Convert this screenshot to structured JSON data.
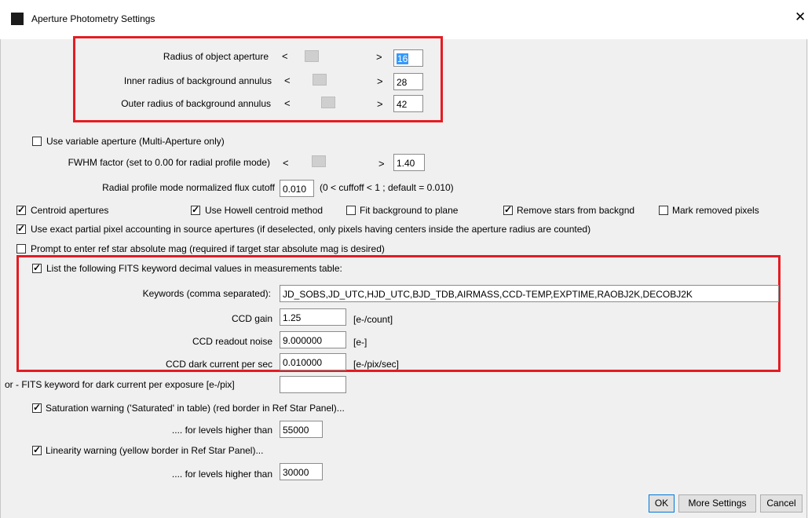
{
  "window": {
    "title": "Aperture Photometry Settings",
    "close_glyph": "✕"
  },
  "apertures": {
    "object_label": "Radius of object aperture",
    "object_value": "16",
    "inner_label": "Inner radius of background annulus",
    "inner_value": "28",
    "outer_label": "Outer radius of background annulus",
    "outer_value": "42",
    "left_arrow": "<",
    "right_arrow": ">"
  },
  "variable_aperture": {
    "label": "Use variable aperture (Multi-Aperture only)",
    "checked": false
  },
  "fwhm": {
    "label": "FWHM factor (set to 0.00 for radial profile mode)",
    "value": "1.40"
  },
  "radial": {
    "label": "Radial profile mode normalized flux cutoff",
    "value": "0.010",
    "hint": "(0 < cuffoff < 1 ; default = 0.010)"
  },
  "options": {
    "centroid": "Centroid apertures",
    "howell": "Use Howell centroid method",
    "fit_bg": "Fit background to plane",
    "remove_stars": "Remove stars from backgnd",
    "mark_removed": "Mark removed pixels",
    "exact_pixel": "Use exact partial pixel accounting in source apertures (if deselected, only pixels having centers inside the aperture radius are counted)",
    "prompt_ref": "Prompt to enter ref star absolute mag (required if target star absolute mag is desired)",
    "check_mark": "✓"
  },
  "fits": {
    "list_label": "List the following FITS keyword decimal values in measurements table:",
    "keywords_label": "Keywords (comma separated):",
    "keywords_value": "JD_SOBS,JD_UTC,HJD_UTC,BJD_TDB,AIRMASS,CCD-TEMP,EXPTIME,RAOBJ2K,DECOBJ2K",
    "gain_label": "CCD gain",
    "gain_value": "1.25",
    "gain_unit": "[e-/count]",
    "noise_label": "CCD readout noise",
    "noise_value": "9.000000",
    "noise_unit": "[e-]",
    "dark_label": "CCD dark current per sec",
    "dark_value": "0.010000",
    "dark_unit": "[e-/pix/sec]"
  },
  "dark_exposure": {
    "label": "or - FITS keyword for dark current per exposure [e-/pix]",
    "value": ""
  },
  "saturation": {
    "label": "Saturation warning ('Saturated' in table) (red border in Ref Star Panel)...",
    "level_label": ".... for levels higher than",
    "value": "55000"
  },
  "linearity": {
    "label": "Linearity warning (yellow border in Ref Star Panel)...",
    "level_label": ".... for levels higher than",
    "value": "30000"
  },
  "buttons": {
    "ok": "OK",
    "more": "More Settings",
    "cancel": "Cancel"
  },
  "colors": {
    "highlight": "#e51c23",
    "selection": "#3399ff"
  }
}
